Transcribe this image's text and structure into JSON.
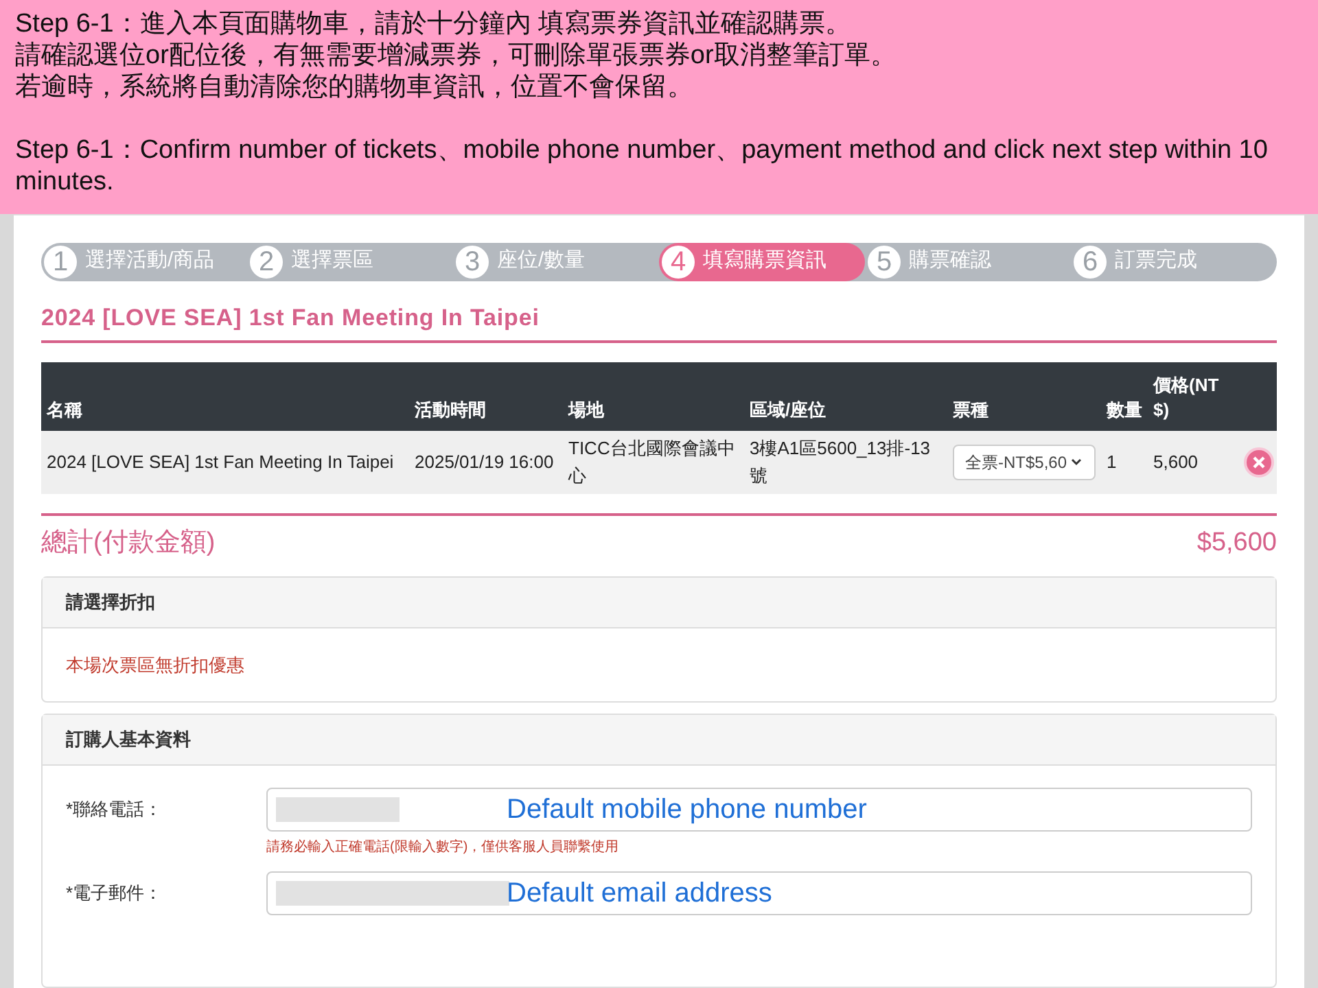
{
  "instructions": {
    "lines": [
      "Step 6-1：進入本頁面購物車，請於十分鐘內  填寫票券資訊並確認購票。",
      "請確認選位or配位後，有無需要增減票券，可刪除單張票券or取消整筆訂單。",
      "若逾時，系統將自動清除您的購物車資訊，位置不會保留。"
    ],
    "english": "Step 6-1：Confirm  number of tickets、mobile phone number、payment method and click next step within 10 minutes."
  },
  "steps": [
    {
      "number": "1",
      "label": "選擇活動/商品",
      "selected": false
    },
    {
      "number": "2",
      "label": "選擇票區",
      "selected": false
    },
    {
      "number": "3",
      "label": "座位/數量",
      "selected": false
    },
    {
      "number": "4",
      "label": "填寫購票資訊",
      "selected": true
    },
    {
      "number": "5",
      "label": "購票確認",
      "selected": false
    },
    {
      "number": "6",
      "label": "訂票完成",
      "selected": false
    }
  ],
  "event_title": "2024 [LOVE SEA] 1st Fan Meeting In Taipei",
  "table": {
    "columns": [
      "名稱",
      "活動時間",
      "場地",
      "區域/座位",
      "票種",
      "數量",
      "價格(NT$)"
    ],
    "rows": [
      {
        "name": "2024 [LOVE SEA] 1st Fan Meeting In Taipei",
        "time": "2025/01/19 16:00",
        "venue": "TICC台北國際會議中心",
        "seat": "3樓A1區5600_13排-13號",
        "ticket_type": "全票-NT$5,60",
        "quantity": "1",
        "price": "5,600"
      }
    ]
  },
  "total": {
    "label": "總計(付款金額)",
    "amount": "$5,600"
  },
  "discount": {
    "title": "請選擇折扣",
    "message": "本場次票區無折扣優惠"
  },
  "buyer": {
    "title": "訂購人基本資料",
    "fields": [
      {
        "label": "*聯絡電話：",
        "annotation": "Default mobile phone number",
        "hint": "請務必輸入正確電話(限輸入數字)，僅供客服人員聯繫使用"
      },
      {
        "label": "*電子郵件：",
        "annotation": "Default email address"
      }
    ]
  }
}
